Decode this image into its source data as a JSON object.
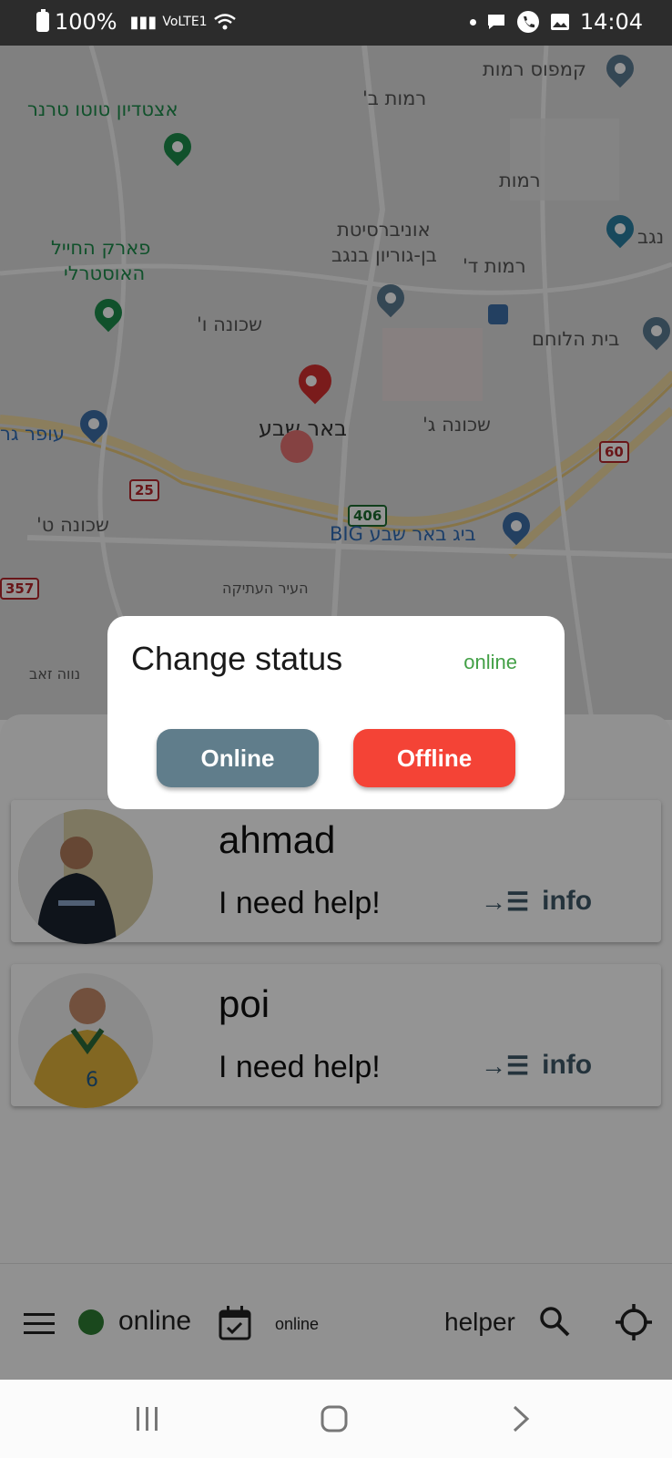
{
  "status_bar": {
    "battery": "100%",
    "network": "VoLTE1",
    "time": "14:04"
  },
  "map_labels": {
    "kampus": "קמפוס רמות",
    "ramot_b": "רמות ב'",
    "estadion": "אצטדיון טוטו טרנר",
    "ramot": "רמות",
    "univ_line1": "אוניברסיטת",
    "univ_line2": "בן-גוריון בנגב",
    "negev": "נגב",
    "park_line1": "פארק החייל",
    "park_line2": "האוסטרלי",
    "ramot_d": "רמות ד'",
    "shchuna_v": "שכונה ו'",
    "beit_halochem": "בית הלוחם",
    "beer_sheva": "באר שבע",
    "shchuna_g": "שכונה ג'",
    "ofer": "עופר גר",
    "big": "ביג באר שבע BIG",
    "shchuna_t": "שכונה ט'",
    "old_city": "העיר העתיקה",
    "neve_zeev": "נווה זאב",
    "road_25": "25",
    "road_406": "406",
    "road_60": "60",
    "road_357": "357"
  },
  "dialog": {
    "title": "Change status",
    "current_status": "online",
    "online_button": "Online",
    "offline_button": "Offline"
  },
  "cards": [
    {
      "name": "ahmad",
      "message": "I need help!",
      "info_label": "info"
    },
    {
      "name": "poi",
      "message": "I need help!",
      "info_label": "info"
    }
  ],
  "bottom_bar": {
    "status": "online",
    "small_status": "online",
    "role": "helper"
  },
  "colors": {
    "online_button": "#607d8b",
    "offline_button": "#f44336",
    "online_indicator": "#2e7d32",
    "status_text": "#43a047"
  }
}
